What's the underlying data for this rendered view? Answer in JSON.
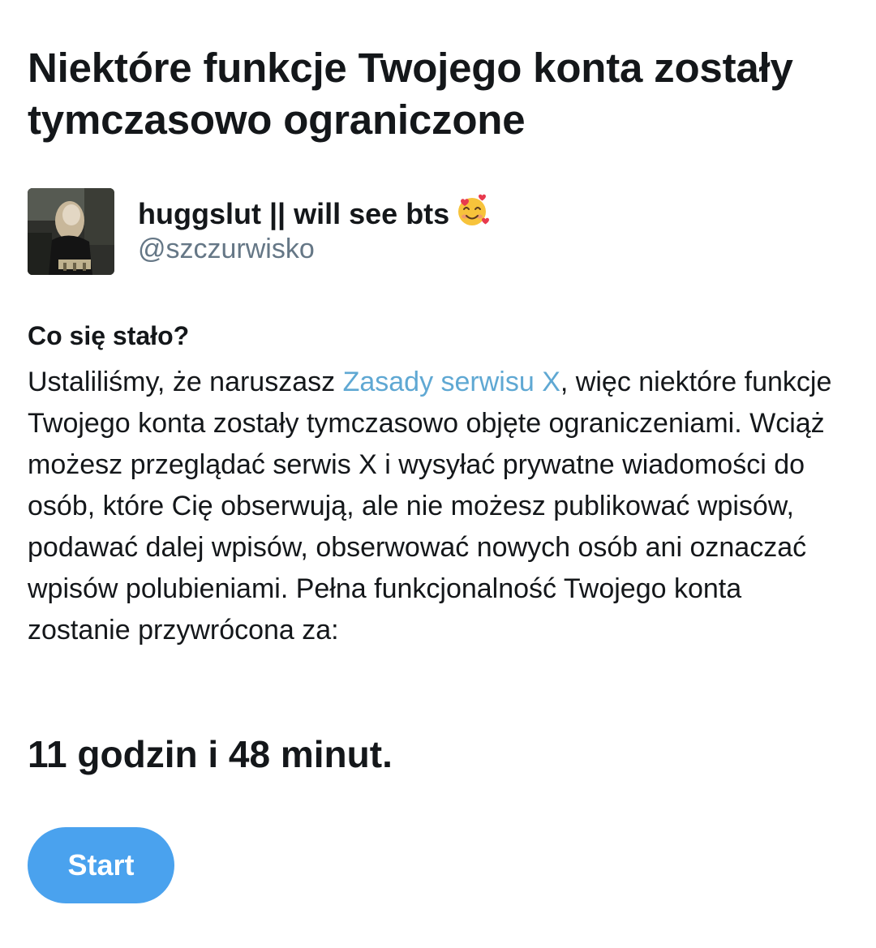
{
  "header": {
    "title": "Niektóre funkcje Twojego konta zostały tymczasowo ograniczone"
  },
  "account": {
    "display_name": "huggslut || will see bts",
    "emoji_icon": "smiling-face-with-hearts-icon",
    "handle": "@szczurwisko"
  },
  "details": {
    "heading": "Co się stało?",
    "text_before_link": "Ustaliliśmy, że naruszasz ",
    "link_label": "Zasady serwisu X",
    "text_after_link": ", więc niektóre funkcje Twojego konta zostały tymczasowo objęte ograniczeniami. Wciąż możesz przeglądać serwis X i wysyłać prywatne wiadomości do osób, które Cię obserwują, ale nie możesz publikować wpisów, podawać dalej wpisów, obserwować nowych osób ani oznaczać wpisów polubieniami. Pełna funkcjonalność Twojego konta zostanie przywrócona za:"
  },
  "countdown": {
    "text": "11 godzin i 48 minut."
  },
  "actions": {
    "start_label": "Start"
  },
  "colors": {
    "link": "#5fa8d3",
    "button": "#4aa2ee",
    "secondary_text": "#657786"
  }
}
